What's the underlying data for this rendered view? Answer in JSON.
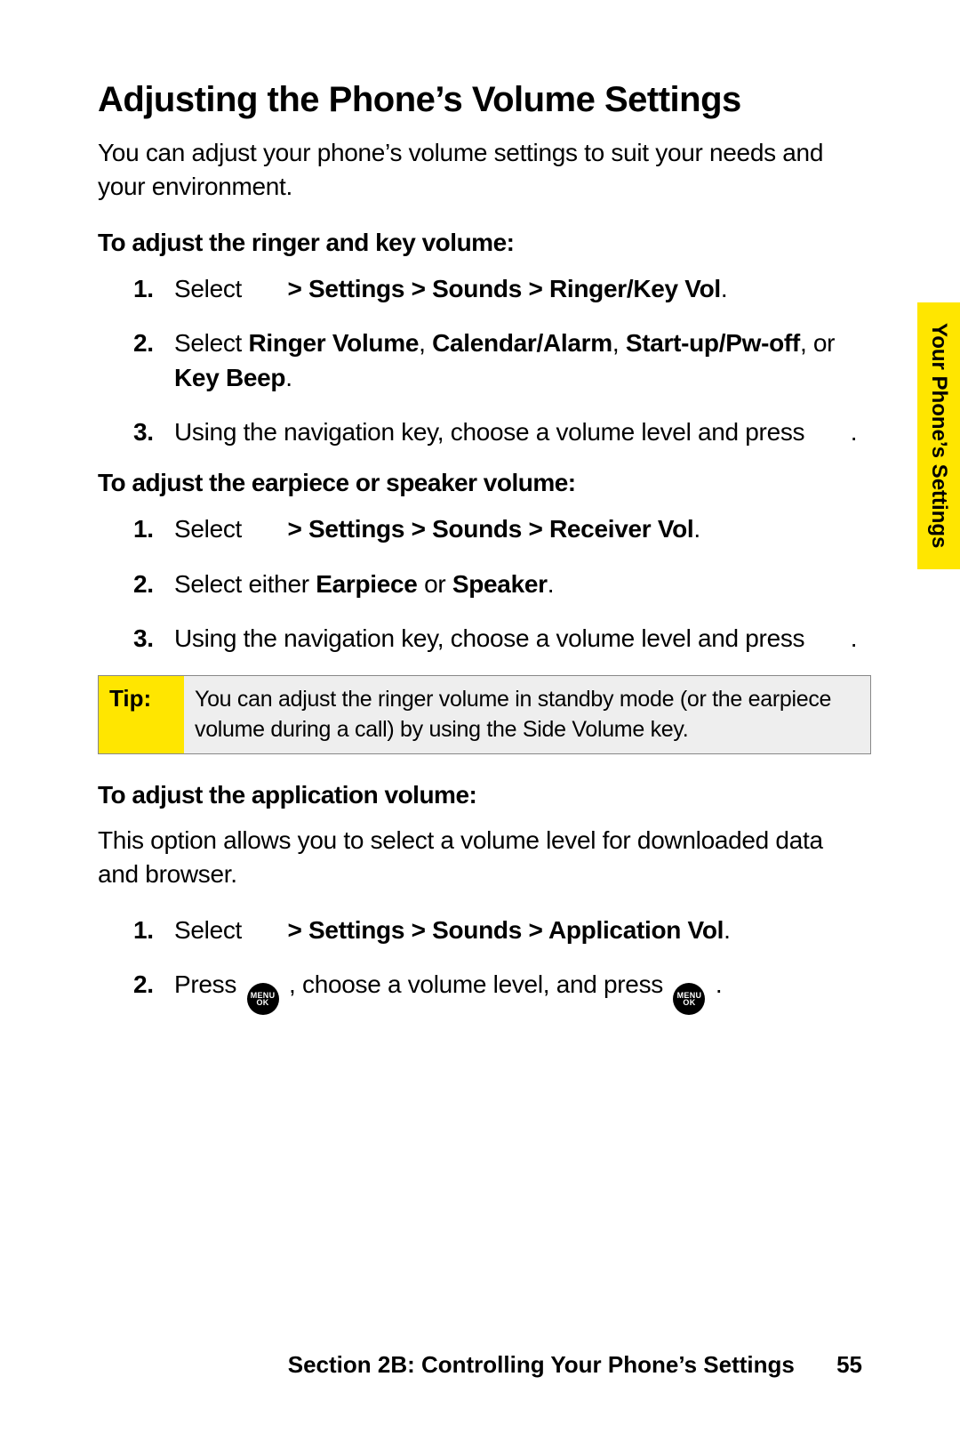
{
  "title": "Adjusting the Phone’s Volume Settings",
  "intro": "You can adjust your phone’s volume settings to suit your needs and your environment.",
  "sub1": "To adjust the ringer and key volume:",
  "list1": {
    "i1_a": "Select",
    "i1_b": " > Settings > Sounds > Ringer/Key Vol",
    "i2_a": "Select ",
    "i2_b1": "Ringer Volume",
    "i2_c1": ", ",
    "i2_b2": "Calendar/Alarm",
    "i2_c2": ", ",
    "i2_b3": "Start-up/Pw-off",
    "i2_c3": ", or ",
    "i2_b4": "Key Beep",
    "i3_a": "Using the navigation key, choose a volume level and press",
    "i3_b": " ."
  },
  "sub2": "To adjust the earpiece or speaker volume:",
  "list2": {
    "i1_a": "Select",
    "i1_b": " > Settings > Sounds > Receiver Vol",
    "i2_a": "Select either ",
    "i2_b1": "Earpiece",
    "i2_c1": " or ",
    "i2_b2": "Speaker",
    "i3_a": "Using the navigation key, choose a volume level and press",
    "i3_b": " ."
  },
  "tip": {
    "label": "Tip:",
    "body": "You can adjust the ringer volume in standby mode (or the earpiece volume during a call) by using the Side Volume key."
  },
  "sub3": "To adjust the application volume:",
  "app_intro": "This option allows you to select a volume level for downloaded data and browser.",
  "list3": {
    "i1_a": "Select",
    "i1_b": " > Settings > Sounds > Application Vol",
    "i2_a": "Press ",
    "i2_b": " , choose a volume level, and press ",
    "i2_c": " ."
  },
  "sidetab": "Your Phone’s Settings",
  "footer": {
    "section": "Section 2B: Controlling Your Phone’s Settings",
    "page": "55"
  },
  "menuok_top": "MENU",
  "menuok_bot": "OK"
}
